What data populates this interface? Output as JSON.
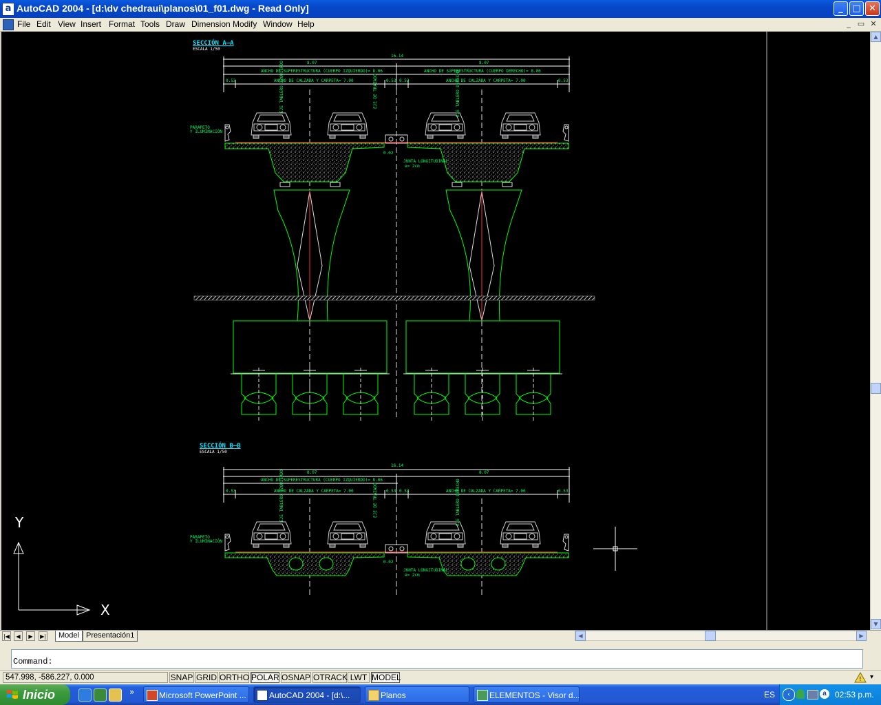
{
  "window": {
    "title": "AutoCAD 2004 - [d:\\dv chedraui\\planos\\01_f01.dwg - Read Only]",
    "app_icon_glyph": "a",
    "minimize": "_",
    "maximize": "□",
    "close": "✕"
  },
  "menu": {
    "items": [
      "File",
      "Edit",
      "View",
      "Insert",
      "Format",
      "Tools",
      "Draw",
      "Dimension",
      "Modify",
      "Window",
      "Help"
    ],
    "mdi_min": "_",
    "mdi_restore": "▭",
    "mdi_close": "✕"
  },
  "drawing": {
    "background": "#000000",
    "line_color": "#00ff00",
    "text_color": "#00ff66",
    "title_color": "#00e5ff",
    "axis_color": "#ff3333",
    "section_a": {
      "title": "SECCIÓN A—A",
      "scale": "ESCALA 1/50",
      "overall_dim": "16.14",
      "left_dim": "8.07",
      "right_dim": "8.07",
      "left_superstructure": "ANCHO DE SUPERESTRUCTURA (CUERPO IZQUIERDO)= 8.06",
      "right_superstructure": "ANCHO DE SUPERESTRUCTURA (CUERPO DERECHO)= 8.06",
      "left_roadway": "ANCHO DE CALZADA Y CARPETA= 7.00",
      "right_roadway": "ANCHO DE CALZADA Y CARPETA= 7.00",
      "edge_left": "0.53",
      "edge_right": "0.53",
      "center_left": "0.53",
      "center_right": "0.53",
      "parapet_label_1": "PARAPETO",
      "parapet_label_2": "Y ILUMINACIÓN",
      "axis_left": "EJE TABLERO IZQUIERDO",
      "axis_center": "EJE DE TRAZADO",
      "axis_right": "EJE TABLERO DERECHO",
      "joint_dim": "0.02",
      "joint_label_1": "JUNTA LONGITUDINAL",
      "joint_label_2": "e= 2cm"
    },
    "section_b": {
      "title": "SECCIÓN B—B",
      "scale": "ESCALA 1/50",
      "overall_dim": "16.14",
      "left_dim": "8.07",
      "right_dim": "8.07",
      "left_superstructure": "ANCHO DE SUPERESTRUCTURA (CUERPO IZQUIERDO)= 8.06",
      "left_roadway": "ANCHO DE CALZADA Y CARPETA= 7.00",
      "right_roadway": "ANCHO DE CALZADA Y CARPETA= 7.00",
      "edge_left": "0.53",
      "edge_right": "0.53",
      "center_left": "0.53",
      "center_right": "0.53",
      "parapet_label_1": "PARAPETO",
      "parapet_label_2": "Y ILUMINACIÓN",
      "axis_left": "EJE TABLERO IZQUIERDO",
      "axis_center": "EJE DE TRAZADO",
      "axis_right": "EJE TABLERO DERECHO",
      "joint_dim": "0.02",
      "joint_label_1": "JUNTA LONGITUDINAL",
      "joint_label_2": "e= 2cm"
    },
    "ucs_y": "Y",
    "ucs_x": "X"
  },
  "tabs": {
    "model": "Model",
    "layout1": "Presentación1"
  },
  "command": {
    "prompt": "Command:"
  },
  "status": {
    "coordinates": "547.998, -586.227, 0.000",
    "toggles": [
      {
        "label": "SNAP",
        "on": false
      },
      {
        "label": "GRID",
        "on": false
      },
      {
        "label": "ORTHO",
        "on": false
      },
      {
        "label": "POLAR",
        "on": true
      },
      {
        "label": "OSNAP",
        "on": false
      },
      {
        "label": "OTRACK",
        "on": false
      },
      {
        "label": "LWT",
        "on": false
      },
      {
        "label": "MODEL",
        "on": true
      }
    ]
  },
  "taskbar": {
    "start": "Inicio",
    "buttons": [
      {
        "label": "Microsoft PowerPoint ...",
        "icon": "powerpoint-icon",
        "active": false
      },
      {
        "label": "AutoCAD 2004 - [d:\\...",
        "icon": "autocad-icon",
        "active": true
      },
      {
        "label": "Planos",
        "icon": "folder-icon",
        "active": false
      },
      {
        "label": "ELEMENTOS - Visor d...",
        "icon": "image-viewer-icon",
        "active": false
      }
    ],
    "language": "ES",
    "clock": "02:53 p.m.",
    "chevron": "»"
  }
}
